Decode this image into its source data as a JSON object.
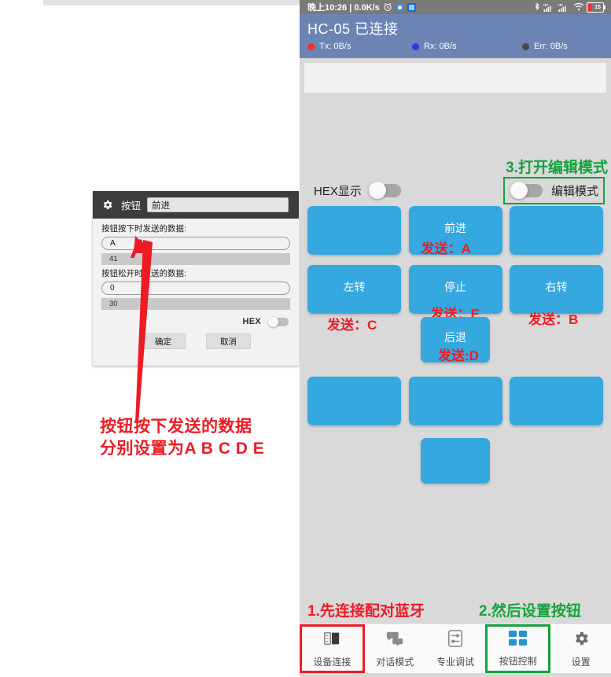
{
  "phone": {
    "statusbar": {
      "time_text": "晚上10:26 | 0.0K/s",
      "icons": [
        "alarm-clock-icon",
        "camera-icon",
        "app-icon",
        "bluetooth-icon",
        "signal-1-icon",
        "signal-2-icon",
        "wifi-icon",
        "battery-icon"
      ],
      "battery_level": "15"
    },
    "appbar": {
      "title": "HC-05 已连接",
      "stats": [
        {
          "label": "Tx: 0B/s",
          "color": "#ff2a2a"
        },
        {
          "label": "Rx: 0B/s",
          "color": "#3333ee"
        },
        {
          "label": "Err: 0B/s",
          "color": "#4a4a4a"
        }
      ]
    },
    "terminal": {
      "text": ""
    },
    "toggles": {
      "hex_display_label": "HEX显示",
      "hex_display_on": false,
      "edit_mode_label": "编辑模式",
      "edit_mode_on": false
    },
    "grid": {
      "rows": [
        [
          {
            "label": "",
            "send": ""
          },
          {
            "label": "前进",
            "send": "发送：A"
          },
          {
            "label": "",
            "send": ""
          }
        ],
        [
          {
            "label": "左转",
            "send": "发送：C"
          },
          {
            "label": "停止",
            "send": "发送：E"
          },
          {
            "label": "右转",
            "send": "发送：B"
          }
        ],
        [
          {
            "label": "后退",
            "send": "发送:D"
          }
        ],
        [
          {
            "label": "",
            "send": ""
          },
          {
            "label": "",
            "send": ""
          },
          {
            "label": "",
            "send": ""
          }
        ],
        [
          {
            "label": "",
            "send": ""
          }
        ]
      ]
    },
    "bottom_nav": [
      {
        "label": "设备连接",
        "icon": "device-connect-icon"
      },
      {
        "label": "对话模式",
        "icon": "chat-bubbles-icon"
      },
      {
        "label": "专业调试",
        "icon": "sliders-icon"
      },
      {
        "label": "按钮控制",
        "icon": "grid-squares-icon"
      },
      {
        "label": "设置",
        "icon": "gear-icon"
      }
    ]
  },
  "dialog": {
    "title": "按钮",
    "name_value": "前进",
    "press_label": "按钮按下时发送的数据:",
    "press_value": "A",
    "press_hex": "41",
    "release_label": "按钮松开时发送的数据:",
    "release_value": "0",
    "release_hex": "30",
    "hex_toggle_label": "HEX",
    "hex_toggle_on": false,
    "ok_label": "确定",
    "cancel_label": "取消"
  },
  "annotations": {
    "big_letter": "A",
    "left_line1": "按钮按下发送的数据",
    "left_line2": "分别设置为A B C D E",
    "hint1": "1.先连接配对蓝牙",
    "hint2": "2.然后设置按钮",
    "hint3": "3.打开编辑模式"
  },
  "colors": {
    "button_blue": "#35a8e0",
    "appbar_blue": "#6b84b4",
    "annotation_red": "#ee1b24",
    "annotation_green": "#14a33c",
    "statusbar_gray": "#7a7a7a"
  }
}
